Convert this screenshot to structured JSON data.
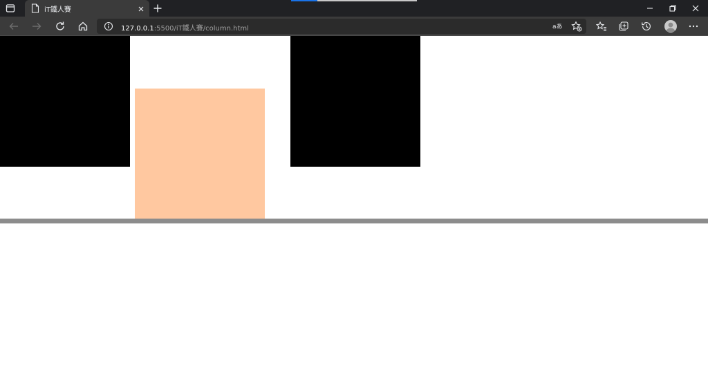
{
  "browser": {
    "tab": {
      "title": "iT鐵人賽",
      "favicon": "page-icon",
      "close": "close-icon"
    },
    "new_tab_icon": "plus-icon",
    "window_controls": [
      "minimize-icon",
      "restore-icon",
      "close-icon"
    ],
    "address_bar": {
      "host": "127.0.0.1",
      "path": ":5500/iT鐵人賽/column.html",
      "info_icon": "info-icon",
      "read_aloud_label": "aあ",
      "favorite_add_icon": "star-plus-icon"
    },
    "toolbar_icons": [
      "back-icon",
      "forward-icon",
      "refresh-icon",
      "home-icon",
      "favorites-icon",
      "collections-icon",
      "history-icon",
      "profile-avatar",
      "more-icon"
    ]
  },
  "colors": {
    "chrome_dark": "#202124",
    "toolbar": "#3b3b3b",
    "omnibox": "#2b2b2b",
    "block_dark": "#000000",
    "block_peach": "#ffc8a0",
    "rule_gray": "#8c8c8c",
    "page_bg": "#ffffff"
  },
  "page": {
    "blocks": [
      "black-box",
      "peach-box",
      "black-box"
    ]
  }
}
